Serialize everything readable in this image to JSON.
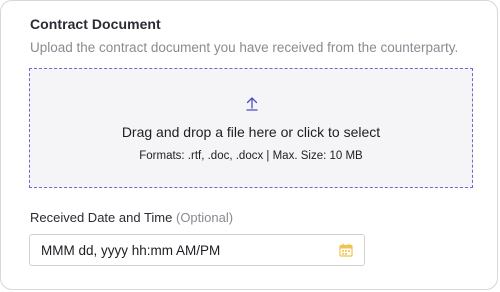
{
  "contract": {
    "title": "Contract Document",
    "description": "Upload the contract document you have received from the counterparty."
  },
  "dropzone": {
    "title": "Drag and drop a file here or click to select",
    "formats": "Formats: .rtf, .doc, .docx | Max. Size: 10 MB",
    "icon": "upload-arrow-icon"
  },
  "received_date": {
    "label": "Received Date and Time",
    "optional": "(Optional)",
    "placeholder": "MMM dd, yyyy hh:mm AM/PM",
    "icon": "calendar-icon"
  },
  "colors": {
    "accent": "#6b6bd6",
    "calendar_icon": "#f2c14e",
    "muted_text": "#8a8a92"
  }
}
